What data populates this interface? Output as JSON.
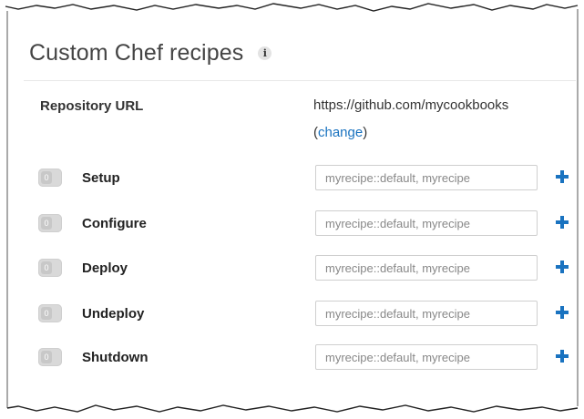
{
  "header": {
    "title": "Custom Chef recipes",
    "info_icon_glyph": "i"
  },
  "repository": {
    "label": "Repository URL",
    "url": "https://github.com/mycookbooks",
    "change_open": "(",
    "change_label": "change",
    "change_close": ")"
  },
  "recipes": [
    {
      "label": "Setup",
      "placeholder": "myrecipe::default, myrecipe",
      "toggle": "0"
    },
    {
      "label": "Configure",
      "placeholder": "myrecipe::default, myrecipe",
      "toggle": "0"
    },
    {
      "label": "Deploy",
      "placeholder": "myrecipe::default, myrecipe",
      "toggle": "0"
    },
    {
      "label": "Undeploy",
      "placeholder": "myrecipe::default, myrecipe",
      "toggle": "0"
    },
    {
      "label": "Shutdown",
      "placeholder": "myrecipe::default, myrecipe",
      "toggle": "0"
    }
  ],
  "colors": {
    "accent": "#1a73c0",
    "title": "#444444"
  }
}
